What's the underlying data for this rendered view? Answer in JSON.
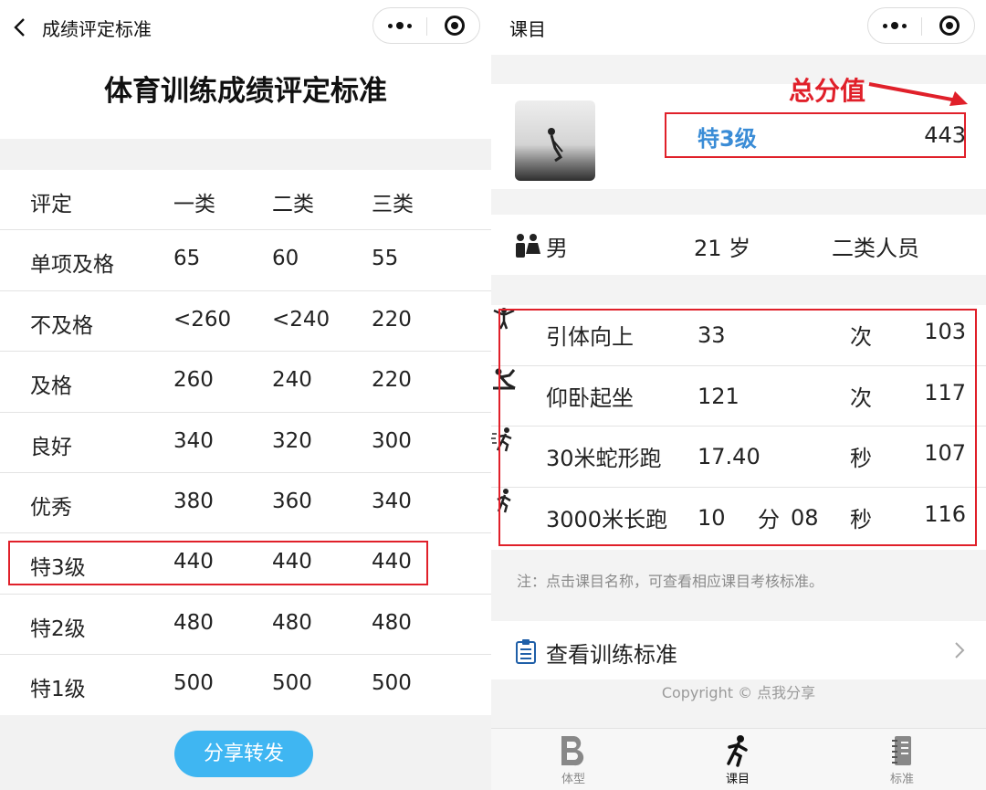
{
  "left": {
    "back_title": "成绩评定标准",
    "page_title": "体育训练成绩评定标准",
    "table": {
      "header": [
        "评定",
        "一类",
        "二类",
        "三类"
      ],
      "rows": [
        [
          "单项及格",
          "65",
          "60",
          "55"
        ],
        [
          "不及格",
          "<260",
          "<240",
          "220"
        ],
        [
          "及格",
          "260",
          "240",
          "220"
        ],
        [
          "良好",
          "340",
          "320",
          "300"
        ],
        [
          "优秀",
          "380",
          "360",
          "340"
        ],
        [
          "特3级",
          "440",
          "440",
          "440"
        ],
        [
          "特2级",
          "480",
          "480",
          "480"
        ],
        [
          "特1级",
          "500",
          "500",
          "500"
        ]
      ]
    },
    "share_label": "分享转发"
  },
  "right": {
    "title": "课目",
    "annotation": "总分值",
    "level": "特3级",
    "total": "443",
    "gender": "男",
    "age": "21 岁",
    "person_type": "二类人员",
    "items": [
      {
        "name": "引体向上",
        "value": "33",
        "unit": "次",
        "score": "103",
        "icon": "pull-up-icon"
      },
      {
        "name": "仰卧起坐",
        "value": "121",
        "unit": "次",
        "score": "117",
        "icon": "sit-up-icon"
      },
      {
        "name": "30米蛇形跑",
        "value": "17.40",
        "unit": "秒",
        "score": "107",
        "icon": "serpentine-run-icon"
      },
      {
        "name": "3000米长跑",
        "value": "10",
        "unit_min": "分",
        "value_sec": "08",
        "unit": "秒",
        "score": "116",
        "icon": "long-run-icon"
      }
    ],
    "note": "注：点击课目名称，可查看相应课目考核标准。",
    "view_standard": "查看训练标准",
    "copyright": "Copyright © 点我分享",
    "tabs": [
      {
        "label": "体型",
        "icon": "body-shape-icon"
      },
      {
        "label": "课目",
        "icon": "runner-icon"
      },
      {
        "label": "标准",
        "icon": "notebook-icon"
      }
    ]
  },
  "colors": {
    "highlight_red": "#e0202a",
    "accent_blue": "#3a8cd6",
    "share_button": "#3fb6f2"
  }
}
